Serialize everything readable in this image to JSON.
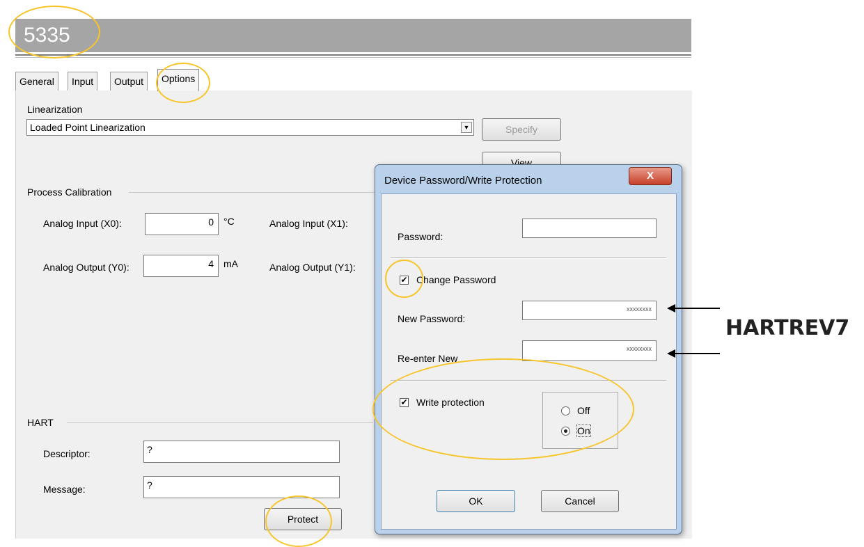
{
  "app": {
    "title": "5335"
  },
  "tabs": [
    {
      "label": "General"
    },
    {
      "label": "Input"
    },
    {
      "label": "Output"
    },
    {
      "label": "Options"
    }
  ],
  "linearization": {
    "group_label": "Linearization",
    "selected": "Loaded Point Linearization",
    "specify_label": "Specify",
    "view_label": "View"
  },
  "process_calibration": {
    "group_label": "Process Calibration",
    "x0_label": "Analog Input (X0):",
    "x0_value": "0",
    "x0_unit": "°C",
    "y0_label": "Analog Output (Y0):",
    "y0_value": "4",
    "y0_unit": "mA",
    "x1_label": "Analog Input (X1):",
    "y1_label": "Analog Output (Y1):"
  },
  "hart": {
    "group_label": "HART",
    "descriptor_label": "Descriptor:",
    "descriptor_value": "?",
    "message_label": "Message:",
    "message_value": "?",
    "protect_label": "Protect"
  },
  "dialog": {
    "title": "Device Password/Write Protection",
    "close_label": "X",
    "password_label": "Password:",
    "password_value": "",
    "change_password_label": "Change Password",
    "change_password_checked": true,
    "new_password_label": "New Password:",
    "new_password_value": "xxxxxxxx",
    "reenter_label": "Re-enter New",
    "reenter_value": "xxxxxxxx",
    "write_protection_label": "Write protection",
    "write_protection_checked": true,
    "off_label": "Off",
    "on_label": "On",
    "selected_mode": "On",
    "ok_label": "OK",
    "cancel_label": "Cancel"
  },
  "annotation": {
    "text": "HARTREV7",
    "highlight_color": "#f7c52a"
  }
}
